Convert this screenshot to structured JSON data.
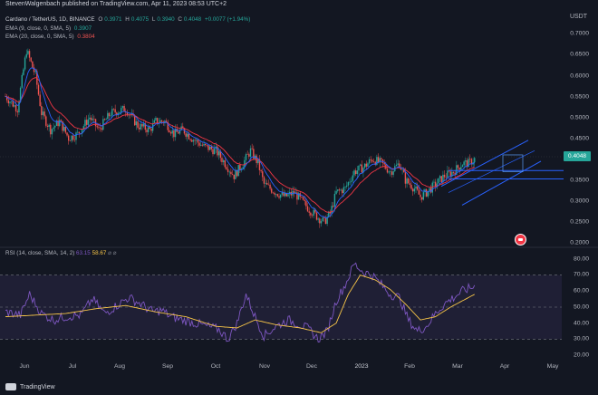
{
  "header": {
    "published_line": "StevenWalgenbach published on TradingView.com, Apr 11, 2023 08:53 UTC+2"
  },
  "legend": {
    "symbol": "Cardano / TetherUS, 1D, BINANCE",
    "open_label": "O",
    "open": "0.3971",
    "high_label": "H",
    "high": "0.4075",
    "low_label": "L",
    "low": "0.3940",
    "close_label": "C",
    "close": "0.4048",
    "change": "+0.0077 (+1.94%)",
    "ema9_label": "EMA (9, close, 0, SMA, 5)",
    "ema9_value": "0.3907",
    "ema20_label": "EMA (20, close, 0, SMA, 5)",
    "ema20_value": "0.3804"
  },
  "price_axis": {
    "currency": "USDT",
    "labels": [
      "0.7000",
      "0.6500",
      "0.6000",
      "0.5500",
      "0.5000",
      "0.4500",
      "0.3500",
      "0.3000",
      "0.2500",
      "0.2000"
    ],
    "current_price": "0.4048"
  },
  "rsi": {
    "label": "RSI (14, close, SMA, 14, 2)",
    "value1": "63.15",
    "value2": "58.67",
    "labels": [
      "80.00",
      "70.00",
      "60.00",
      "50.00",
      "40.00",
      "30.00",
      "20.00"
    ]
  },
  "time_axis": {
    "labels": [
      "Jun",
      "Jul",
      "Aug",
      "Sep",
      "Oct",
      "Nov",
      "Dec",
      "2023",
      "Feb",
      "Mar",
      "Apr",
      "May"
    ]
  },
  "footer": {
    "brand": "TradingView"
  },
  "colors": {
    "background": "#131722",
    "up": "#26a69a",
    "down": "#ef5350",
    "ema9": "#2962ff",
    "ema20": "#f23645",
    "rsi_line": "#7e57c2",
    "rsi_ma": "#f7c548"
  },
  "chart_data": {
    "type": "candlestick",
    "title": "Cardano / TetherUS, 1D, BINANCE",
    "ylim": [
      0.2,
      0.72
    ],
    "x_months": [
      "Jun",
      "Jul",
      "Aug",
      "Sep",
      "Oct",
      "Nov",
      "Dec",
      "2023",
      "Feb",
      "Mar",
      "Apr",
      "May"
    ],
    "price_path": [
      [
        0,
        0.55
      ],
      [
        8,
        0.52
      ],
      [
        14,
        0.66
      ],
      [
        20,
        0.6
      ],
      [
        24,
        0.51
      ],
      [
        30,
        0.47
      ],
      [
        36,
        0.49
      ],
      [
        42,
        0.45
      ],
      [
        48,
        0.46
      ],
      [
        56,
        0.5
      ],
      [
        62,
        0.47
      ],
      [
        70,
        0.51
      ],
      [
        80,
        0.52
      ],
      [
        88,
        0.48
      ],
      [
        96,
        0.47
      ],
      [
        100,
        0.49
      ],
      [
        106,
        0.49
      ],
      [
        112,
        0.46
      ],
      [
        118,
        0.47
      ],
      [
        124,
        0.45
      ],
      [
        132,
        0.43
      ],
      [
        140,
        0.42
      ],
      [
        148,
        0.38
      ],
      [
        152,
        0.36
      ],
      [
        158,
        0.39
      ],
      [
        163,
        0.42
      ],
      [
        168,
        0.39
      ],
      [
        172,
        0.34
      ],
      [
        180,
        0.32
      ],
      [
        186,
        0.31
      ],
      [
        192,
        0.32
      ],
      [
        197,
        0.3
      ],
      [
        202,
        0.28
      ],
      [
        208,
        0.26
      ],
      [
        212,
        0.25
      ],
      [
        216,
        0.27
      ],
      [
        220,
        0.32
      ],
      [
        226,
        0.33
      ],
      [
        232,
        0.37
      ],
      [
        238,
        0.38
      ],
      [
        244,
        0.4
      ],
      [
        250,
        0.39
      ],
      [
        256,
        0.37
      ],
      [
        262,
        0.39
      ],
      [
        266,
        0.35
      ],
      [
        272,
        0.33
      ],
      [
        276,
        0.31
      ],
      [
        280,
        0.32
      ],
      [
        286,
        0.34
      ],
      [
        292,
        0.36
      ],
      [
        298,
        0.37
      ],
      [
        304,
        0.39
      ],
      [
        308,
        0.39
      ],
      [
        312,
        0.4
      ]
    ],
    "ema9_end": 0.3907,
    "ema20_end": 0.3804,
    "horizontal_levels": [
      0.3725,
      0.3525
    ],
    "rsi_range": [
      20,
      80
    ],
    "rsi_path": [
      [
        0,
        47
      ],
      [
        10,
        45
      ],
      [
        16,
        58
      ],
      [
        24,
        46
      ],
      [
        32,
        42
      ],
      [
        40,
        44
      ],
      [
        50,
        45
      ],
      [
        58,
        55
      ],
      [
        66,
        46
      ],
      [
        74,
        51
      ],
      [
        82,
        56
      ],
      [
        90,
        52
      ],
      [
        98,
        47
      ],
      [
        104,
        48
      ],
      [
        110,
        44
      ],
      [
        118,
        42
      ],
      [
        126,
        40
      ],
      [
        134,
        38
      ],
      [
        142,
        36
      ],
      [
        148,
        30
      ],
      [
        154,
        40
      ],
      [
        160,
        58
      ],
      [
        166,
        44
      ],
      [
        172,
        32
      ],
      [
        180,
        38
      ],
      [
        188,
        42
      ],
      [
        196,
        39
      ],
      [
        202,
        36
      ],
      [
        208,
        30
      ],
      [
        214,
        35
      ],
      [
        220,
        54
      ],
      [
        226,
        64
      ],
      [
        232,
        77
      ],
      [
        238,
        72
      ],
      [
        244,
        70
      ],
      [
        250,
        64
      ],
      [
        256,
        58
      ],
      [
        262,
        56
      ],
      [
        268,
        42
      ],
      [
        274,
        35
      ],
      [
        280,
        38
      ],
      [
        286,
        46
      ],
      [
        292,
        52
      ],
      [
        298,
        56
      ],
      [
        304,
        60
      ],
      [
        312,
        63
      ]
    ],
    "rsi_ma_path": [
      [
        0,
        44
      ],
      [
        20,
        45
      ],
      [
        40,
        46
      ],
      [
        60,
        49
      ],
      [
        80,
        51
      ],
      [
        100,
        47
      ],
      [
        120,
        44
      ],
      [
        140,
        38
      ],
      [
        154,
        37
      ],
      [
        166,
        42
      ],
      [
        180,
        39
      ],
      [
        196,
        37
      ],
      [
        210,
        34
      ],
      [
        220,
        40
      ],
      [
        228,
        58
      ],
      [
        236,
        70
      ],
      [
        246,
        67
      ],
      [
        256,
        61
      ],
      [
        266,
        52
      ],
      [
        276,
        42
      ],
      [
        286,
        44
      ],
      [
        296,
        50
      ],
      [
        306,
        55
      ],
      [
        312,
        58
      ]
    ]
  }
}
